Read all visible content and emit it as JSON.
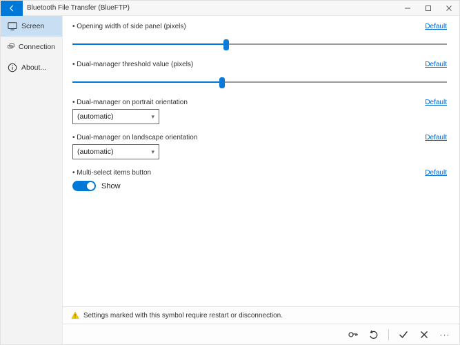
{
  "window": {
    "title": "Bluetooth File Transfer (BlueFTP)"
  },
  "sidebar": {
    "items": [
      {
        "label": "Screen"
      },
      {
        "label": "Connection"
      },
      {
        "label": "About..."
      }
    ]
  },
  "settings": {
    "default_label": "Default",
    "opening_width": {
      "label": "Opening width of side panel (pixels)",
      "percent": 41
    },
    "threshold": {
      "label": "Dual-manager threshold value (pixels)",
      "percent": 40
    },
    "portrait": {
      "label": "Dual-manager on portrait orientation",
      "value": "(automatic)"
    },
    "landscape": {
      "label": "Dual-manager on landscape orientation",
      "value": "(automatic)"
    },
    "multiselect": {
      "label": "Multi-select items button",
      "state_label": "Show"
    }
  },
  "notice": {
    "text": "Settings marked with this symbol require restart or disconnection."
  }
}
